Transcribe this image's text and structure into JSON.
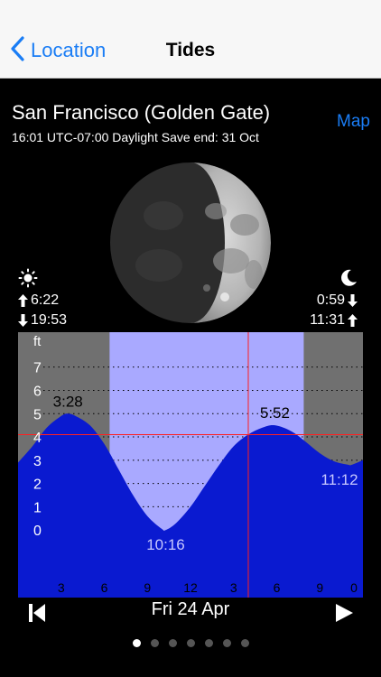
{
  "navbar": {
    "back_label": "Location",
    "title": "Tides"
  },
  "location": {
    "name": "San Francisco (Golden Gate)",
    "time_info": "16:01 UTC-07:00  Daylight Save end: 31 Oct",
    "map_label": "Map"
  },
  "sun": {
    "rise": "6:22",
    "set": "19:53"
  },
  "moon": {
    "rise": "0:59",
    "set": "11:31"
  },
  "chart_data": {
    "type": "area",
    "ylabel": "ft",
    "y_ticks": [
      "7",
      "6",
      "5",
      "4",
      "3",
      "2",
      "1",
      "0"
    ],
    "x_ticks": [
      "3",
      "6",
      "9",
      "12",
      "3",
      "6",
      "9",
      "0"
    ],
    "x_range_hours": [
      0,
      24
    ],
    "y_range_ft": [
      -2.9,
      8.5
    ],
    "daylight_hours": [
      6.37,
      19.88
    ],
    "current_time_hours": 16.02,
    "current_level_ft": 4.1,
    "events": [
      {
        "label": "3:28",
        "hour": 3.47,
        "ft": 5.0,
        "kind": "high"
      },
      {
        "label": "10:16",
        "hour": 10.27,
        "ft": 0.0,
        "kind": "low"
      },
      {
        "label": "5:52",
        "hour": 17.87,
        "ft": 4.5,
        "kind": "high"
      },
      {
        "label": "11:12",
        "hour": 23.2,
        "ft": 2.8,
        "kind": "low"
      }
    ],
    "series": [
      {
        "x": [
          0,
          1,
          2,
          3,
          3.47,
          4,
          5,
          6,
          7,
          8,
          9,
          10,
          10.27,
          11,
          12,
          13,
          14,
          15,
          16,
          17,
          17.87,
          19,
          20,
          21,
          22,
          23,
          23.2,
          24
        ],
        "values": [
          2.9,
          3.6,
          4.4,
          4.9,
          5.0,
          4.9,
          4.5,
          3.7,
          2.6,
          1.5,
          0.6,
          0.05,
          0.0,
          0.3,
          1.0,
          1.9,
          2.8,
          3.6,
          4.1,
          4.4,
          4.5,
          4.25,
          3.8,
          3.3,
          2.95,
          2.8,
          2.8,
          3.0
        ]
      }
    ],
    "colors": {
      "water": "#0a1ad0",
      "day": "#a9a9ff",
      "night": "#707070",
      "now_line": "#ff2020",
      "grid": "#000000",
      "label_day": "#c8c8ff"
    }
  },
  "date_nav": {
    "date": "Fri 24 Apr"
  },
  "pages": {
    "count": 7,
    "active": 0
  }
}
